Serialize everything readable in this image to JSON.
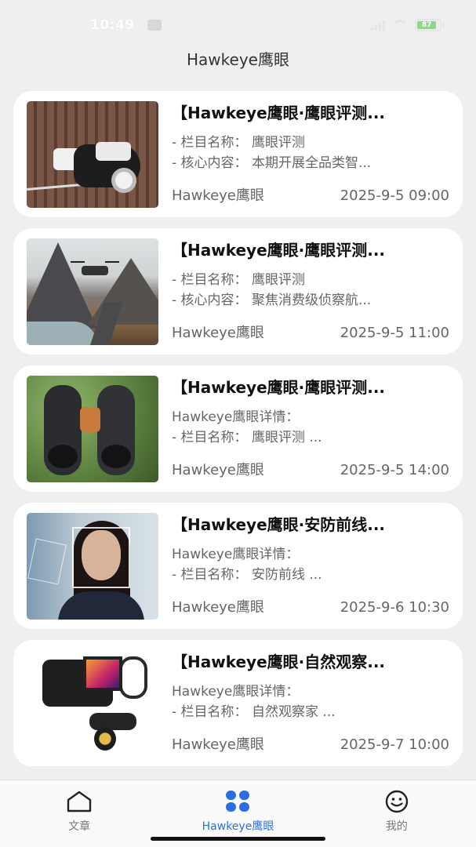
{
  "status_bar": {
    "time": "10:49",
    "battery": "87"
  },
  "header": {
    "title": "Hawkeye鹰眼"
  },
  "articles": [
    {
      "title": "【Hawkeye鹰眼·鹰眼评测...",
      "lines": [
        "- 栏目名称： 鹰眼评测",
        "- 核心内容： 本期开展全品类智..."
      ],
      "source": "Hawkeye鹰眼",
      "date": "2025-9-5 09:00",
      "thumb_icon": "security-camera-image"
    },
    {
      "title": "【Hawkeye鹰眼·鹰眼评测...",
      "lines": [
        "- 栏目名称： 鹰眼评测",
        "- 核心内容： 聚焦消费级侦察航..."
      ],
      "source": "Hawkeye鹰眼",
      "date": "2025-9-5 11:00",
      "thumb_icon": "drone-landscape-image"
    },
    {
      "title": "【Hawkeye鹰眼·鹰眼评测...",
      "lines": [
        "Hawkeye鹰眼详情：",
        "- 栏目名称： 鹰眼评测 ..."
      ],
      "source": "Hawkeye鹰眼",
      "date": "2025-9-5 14:00",
      "thumb_icon": "binoculars-image"
    },
    {
      "title": "【Hawkeye鹰眼·安防前线...",
      "lines": [
        "Hawkeye鹰眼详情：",
        "- 栏目名称： 安防前线 ..."
      ],
      "source": "Hawkeye鹰眼",
      "date": "2025-9-6 10:30",
      "thumb_icon": "face-recognition-image"
    },
    {
      "title": "【Hawkeye鹰眼·自然观察...",
      "lines": [
        "Hawkeye鹰眼详情：",
        "- 栏目名称： 自然观察家 ..."
      ],
      "source": "Hawkeye鹰眼",
      "date": "2025-9-7 10:00",
      "thumb_icon": "thermal-camera-image"
    }
  ],
  "tabbar": {
    "tabs": [
      {
        "label": "文章",
        "icon": "home-icon",
        "active": false
      },
      {
        "label": "Hawkeye鹰眼",
        "icon": "four-petal-icon",
        "active": true
      },
      {
        "label": "我的",
        "icon": "smiley-icon",
        "active": false
      }
    ],
    "active_color": "#2a6fe0"
  }
}
